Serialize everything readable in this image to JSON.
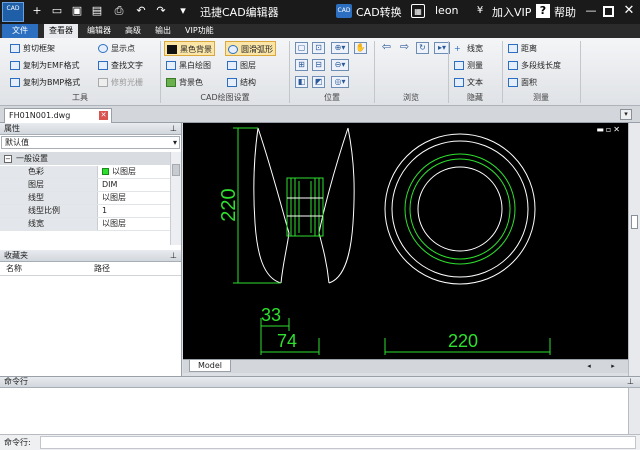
{
  "app": {
    "logo_text": "CAD",
    "title": "迅捷CAD编辑器",
    "cad_convert": "CAD转换",
    "user": "leon",
    "vip": "加入VIP",
    "help": "帮助"
  },
  "menu": {
    "file": "文件",
    "tabs": [
      "查看器",
      "编辑器",
      "高级",
      "输出",
      "VIP功能"
    ]
  },
  "ribbon": {
    "tools": {
      "clip": "剪切框架",
      "copy_emf": "复制为EMF格式",
      "copy_bmp": "复制为BMP格式",
      "show_point": "显示点",
      "find_text": "查找文字",
      "trim_raster": "修剪光栅",
      "label": "工具"
    },
    "draw_settings": {
      "black_bg": "黑色背景",
      "bw_draw": "黑白绘图",
      "bg_color": "背景色",
      "smooth_arc": "圆滑弧形",
      "layers": "图层",
      "structure": "结构",
      "label": "CAD绘图设置"
    },
    "position": {
      "label": "位置"
    },
    "browse": {
      "label": "浏览"
    },
    "hide": {
      "linewidth": "线宽",
      "measure": "测量",
      "text": "文本",
      "label": "隐藏"
    },
    "measure": {
      "distance": "距离",
      "polyline_length": "多段线长度",
      "area": "面积",
      "label": "测量"
    }
  },
  "doc_tab": "FH01N001.dwg",
  "properties": {
    "title": "属性",
    "filter": "默认值",
    "section": "一般设置",
    "rows": [
      {
        "key": "色彩",
        "value": "以图层"
      },
      {
        "key": "图层",
        "value": "DIM"
      },
      {
        "key": "线型",
        "value": "以图层"
      },
      {
        "key": "线型比例",
        "value": "1"
      },
      {
        "key": "线宽",
        "value": "以图层"
      }
    ]
  },
  "favorites": {
    "title": "收藏夹",
    "col_name": "名称",
    "col_path": "路径"
  },
  "drawing": {
    "dims": [
      "220",
      "33",
      "74",
      "220"
    ],
    "colors": {
      "dim": "#2ee02e",
      "geometry": "#ffffff",
      "background": "#000000"
    }
  },
  "model_tab": "Model",
  "command": {
    "title": "命令行",
    "prompt": "命令行:"
  }
}
